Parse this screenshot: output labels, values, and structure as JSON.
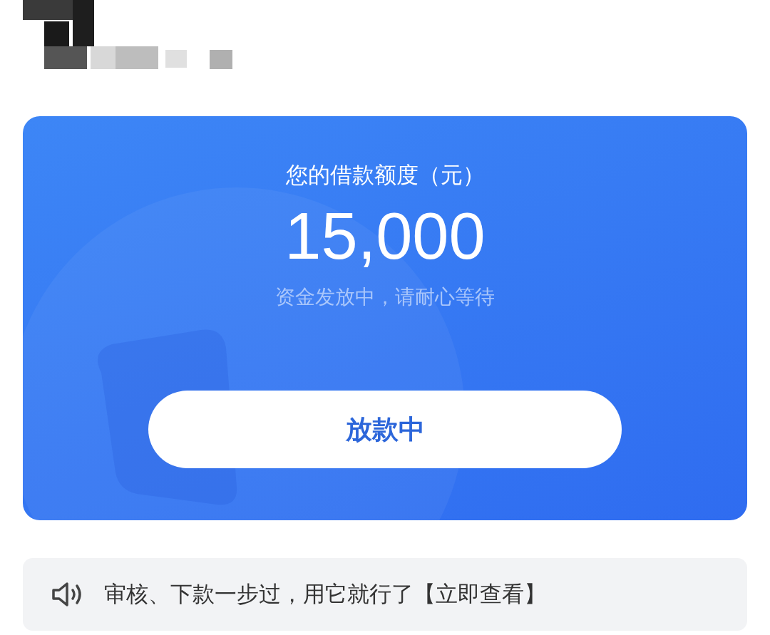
{
  "loan_card": {
    "title": "您的借款额度（元）",
    "amount": "15,000",
    "status_note": "资金发放中，请耐心等待",
    "button": {
      "label": "放款中",
      "disabled": true
    }
  },
  "notice": {
    "text": "审核、下款一步过，用它就行了【立即查看】"
  }
}
